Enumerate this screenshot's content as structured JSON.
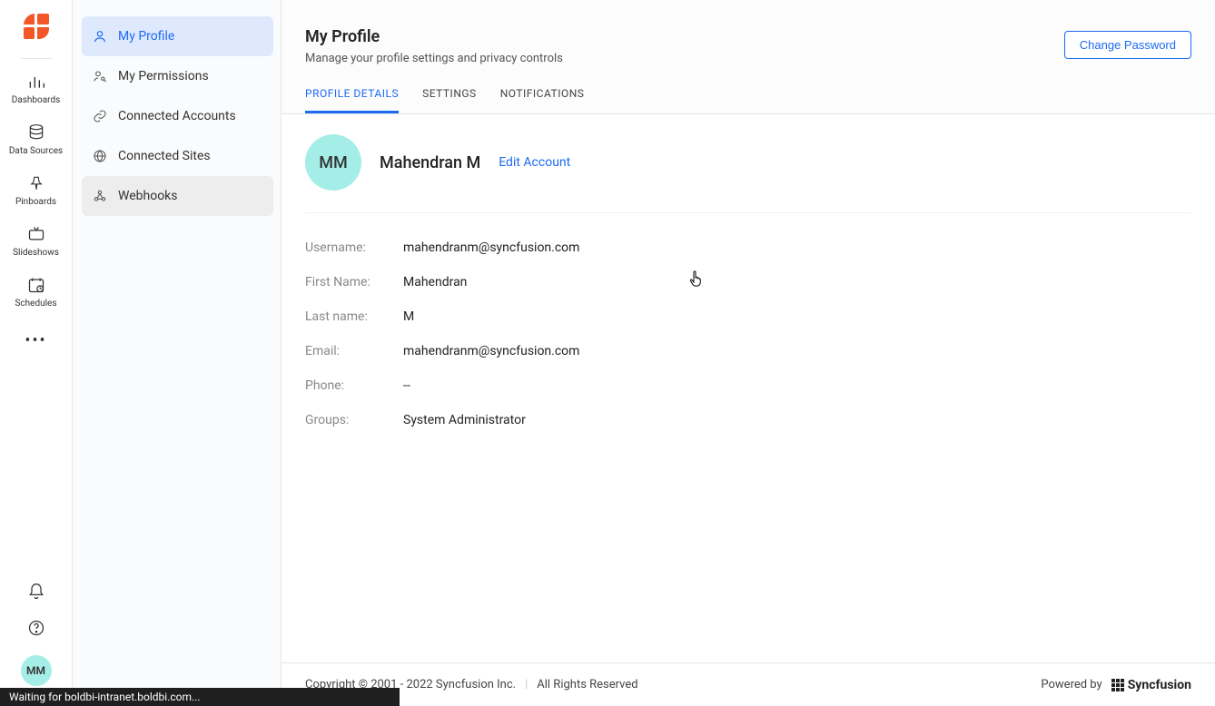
{
  "rail": {
    "items": [
      {
        "label": "Dashboards"
      },
      {
        "label": "Data Sources"
      },
      {
        "label": "Pinboards"
      },
      {
        "label": "Slideshows"
      },
      {
        "label": "Schedules"
      }
    ],
    "avatar_initials": "MM"
  },
  "subnav": {
    "items": [
      {
        "label": "My Profile"
      },
      {
        "label": "My Permissions"
      },
      {
        "label": "Connected Accounts"
      },
      {
        "label": "Connected Sites"
      },
      {
        "label": "Webhooks"
      }
    ]
  },
  "header": {
    "title": "My Profile",
    "subtitle": "Manage your profile settings and privacy controls",
    "change_password": "Change Password"
  },
  "tabs": [
    {
      "label": "PROFILE DETAILS"
    },
    {
      "label": "SETTINGS"
    },
    {
      "label": "NOTIFICATIONS"
    }
  ],
  "profile": {
    "avatar_initials": "MM",
    "display_name": "Mahendran M",
    "edit_label": "Edit Account",
    "fields": [
      {
        "label": "Username:",
        "value": "mahendranm@syncfusion.com"
      },
      {
        "label": "First Name:",
        "value": "Mahendran"
      },
      {
        "label": "Last name:",
        "value": "M"
      },
      {
        "label": "Email:",
        "value": "mahendranm@syncfusion.com"
      },
      {
        "label": "Phone:",
        "value": "--"
      },
      {
        "label": "Groups:",
        "value": "System Administrator"
      }
    ]
  },
  "footer": {
    "copyright": "Copyright © 2001 - 2022 Syncfusion Inc.",
    "rights": "All Rights Reserved",
    "powered_by": "Powered by",
    "brand": "Syncfusion"
  },
  "status": "Waiting for boldbi-intranet.boldbi.com..."
}
